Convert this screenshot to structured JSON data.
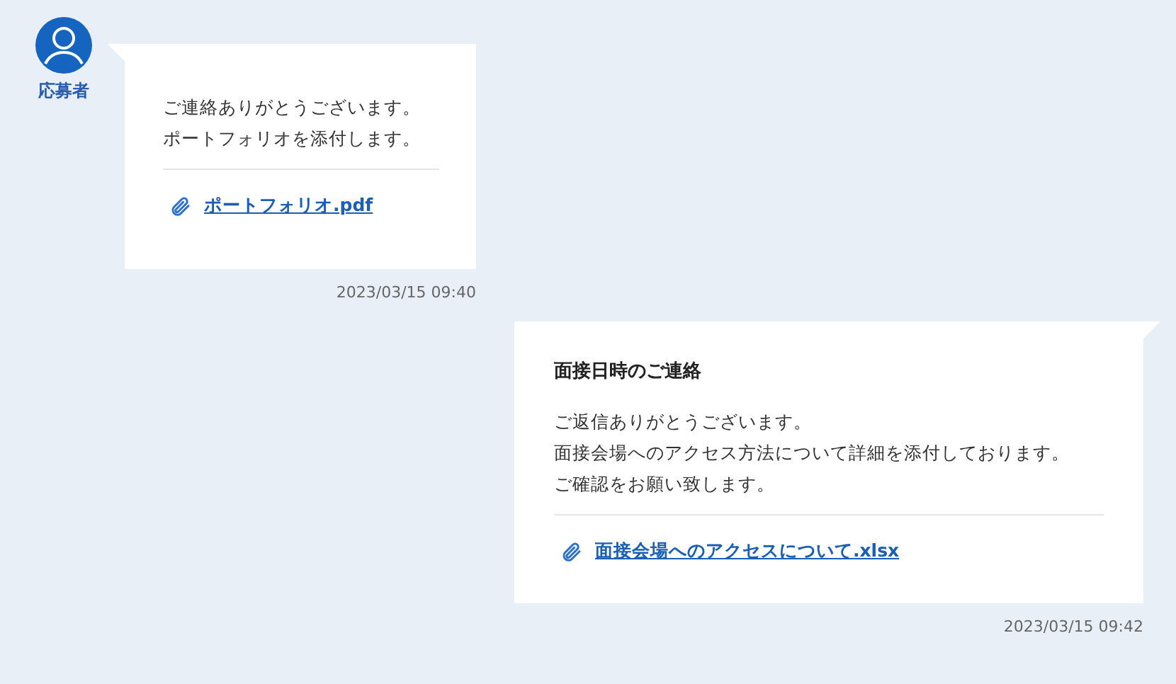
{
  "messages": [
    {
      "kind": "incoming",
      "sender": "応募者",
      "lines": [
        "ご連絡ありがとうございます。",
        "ポートフォリオを添付します。"
      ],
      "attachment": "ポートフォリオ.pdf",
      "time": "2023/03/15 09:40"
    },
    {
      "kind": "outgoing",
      "subject": "面接日時のご連絡",
      "lines": [
        "ご返信ありがとうございます。",
        "面接会場へのアクセス方法について詳細を添付しております。",
        "ご確認をお願い致します。"
      ],
      "attachment": "面接会場へのアクセスについて.xlsx",
      "time": "2023/03/15 09:42"
    }
  ]
}
